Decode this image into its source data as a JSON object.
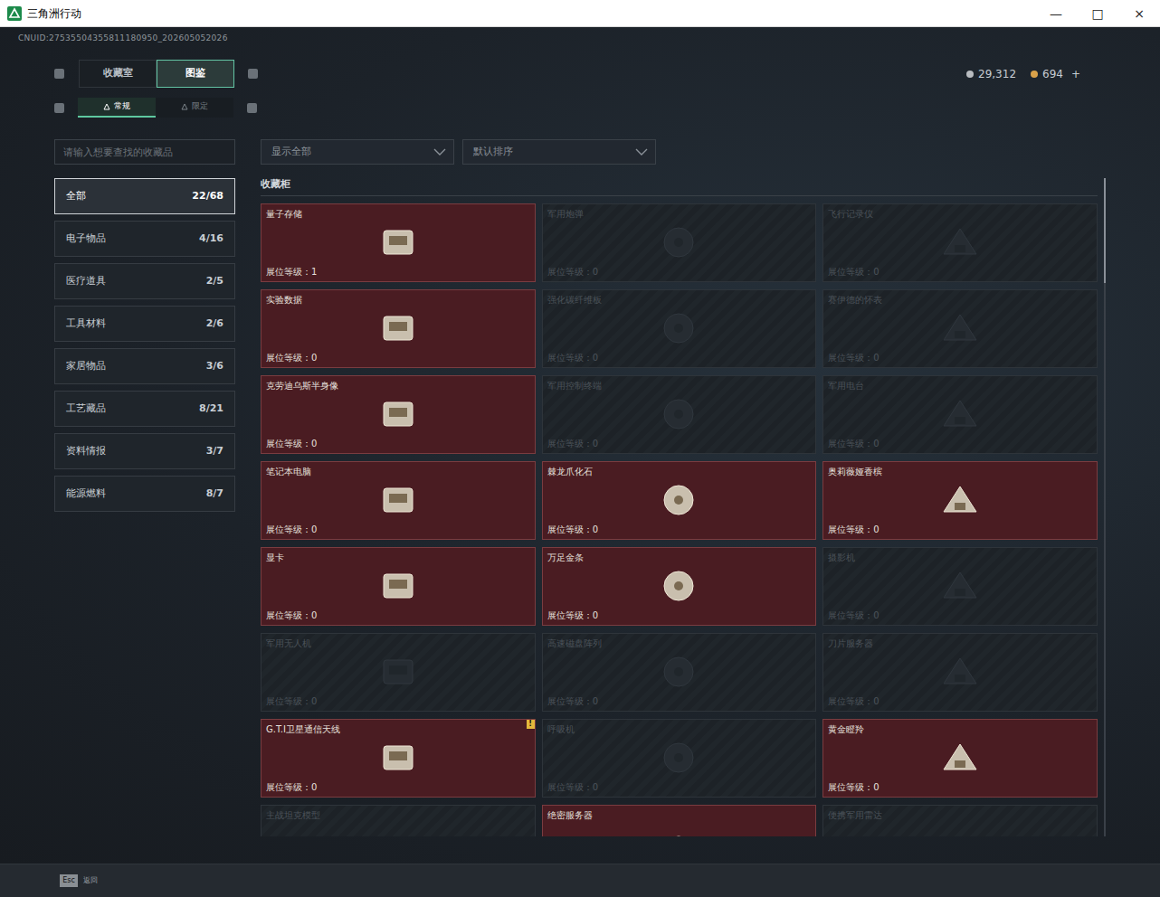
{
  "window": {
    "title": "三角洲行动",
    "controls": [
      "—",
      "□",
      "×"
    ]
  },
  "cnuid": "CNUID:27535504355811180950_202605052026",
  "main_tabs": [
    {
      "label": "收藏室",
      "selected": false
    },
    {
      "label": "图鉴",
      "selected": true
    }
  ],
  "sub_tabs": [
    {
      "label": "常规",
      "selected": true
    },
    {
      "label": "限定",
      "selected": false
    }
  ],
  "currencies": [
    {
      "amount": "29,312",
      "color": "#b8bcc0"
    },
    {
      "amount": "694",
      "color": "#d9a24a"
    }
  ],
  "add_button": "+",
  "search": {
    "placeholder": "请输入想要查找的收藏品"
  },
  "categories": [
    {
      "label": "全部",
      "count": "22/68",
      "selected": true
    },
    {
      "label": "电子物品",
      "count": "4/16",
      "selected": false
    },
    {
      "label": "医疗道具",
      "count": "2/5",
      "selected": false
    },
    {
      "label": "工具材料",
      "count": "2/6",
      "selected": false
    },
    {
      "label": "家居物品",
      "count": "3/6",
      "selected": false
    },
    {
      "label": "工艺藏品",
      "count": "8/21",
      "selected": false
    },
    {
      "label": "资料情报",
      "count": "3/7",
      "selected": false
    },
    {
      "label": "能源燃料",
      "count": "8/7",
      "selected": false
    }
  ],
  "filters": [
    {
      "label": "显示全部"
    },
    {
      "label": "默认排序"
    }
  ],
  "section_title": "收藏柜",
  "items": [
    {
      "name": "量子存储",
      "collected": true,
      "level_label": "展位等级：",
      "level": "1"
    },
    {
      "name": "军用炮弹",
      "collected": false,
      "level_label": "展位等级：",
      "level": "0"
    },
    {
      "name": "飞行记录仪",
      "collected": false,
      "level_label": "展位等级：",
      "level": "0"
    },
    {
      "name": "实验数据",
      "collected": true,
      "level_label": "展位等级：",
      "level": "0"
    },
    {
      "name": "强化碳纤维板",
      "collected": false,
      "level_label": "展位等级：",
      "level": "0"
    },
    {
      "name": "赛伊德的怀表",
      "collected": false,
      "level_label": "展位等级：",
      "level": "0"
    },
    {
      "name": "克劳迪乌斯半身像",
      "collected": true,
      "level_label": "展位等级：",
      "level": "0"
    },
    {
      "name": "军用控制终端",
      "collected": false,
      "level_label": "展位等级：",
      "level": "0"
    },
    {
      "name": "军用电台",
      "collected": false,
      "level_label": "展位等级：",
      "level": "0"
    },
    {
      "name": "笔记本电脑",
      "collected": true,
      "level_label": "展位等级：",
      "level": "0"
    },
    {
      "name": "棘龙爪化石",
      "collected": true,
      "level_label": "展位等级：",
      "level": "0"
    },
    {
      "name": "奥莉薇娅香槟",
      "collected": true,
      "level_label": "展位等级：",
      "level": "0"
    },
    {
      "name": "显卡",
      "collected": true,
      "level_label": "展位等级：",
      "level": "0"
    },
    {
      "name": "万足金条",
      "collected": true,
      "level_label": "展位等级：",
      "level": "0"
    },
    {
      "name": "摄影机",
      "collected": false,
      "level_label": "展位等级：",
      "level": "0"
    },
    {
      "name": "军用无人机",
      "collected": false,
      "level_label": "展位等级：",
      "level": "0"
    },
    {
      "name": "高速磁盘阵列",
      "collected": false,
      "level_label": "展位等级：",
      "level": "0"
    },
    {
      "name": "刀片服务器",
      "collected": false,
      "level_label": "展位等级：",
      "level": "0"
    },
    {
      "name": "G.T.I卫星通信天线",
      "collected": true,
      "level_label": "展位等级：",
      "level": "0",
      "badge": "!"
    },
    {
      "name": "呼吸机",
      "collected": false,
      "level_label": "展位等级：",
      "level": "0"
    },
    {
      "name": "黄金瞪羚",
      "collected": true,
      "level_label": "展位等级：",
      "level": "0"
    },
    {
      "name": "主战坦克模型",
      "collected": false
    },
    {
      "name": "绝密服务器",
      "collected": true
    },
    {
      "name": "便携军用雷达",
      "collected": false
    }
  ],
  "scrollbar": {
    "level": 0.16
  },
  "footer": {
    "key": "Esc",
    "label": "返回"
  }
}
